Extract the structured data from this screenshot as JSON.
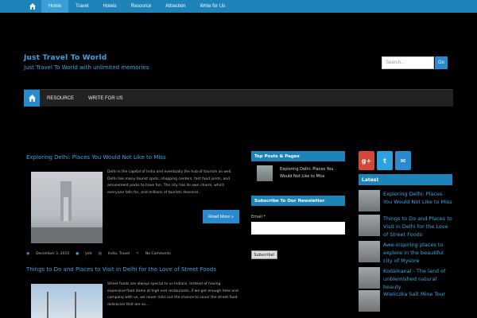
{
  "topnav": {
    "items": [
      "Home",
      "Travel",
      "Hotels",
      "Resource",
      "Attraction",
      "Write for Us"
    ]
  },
  "header": {
    "title": "Just Travel To World",
    "tagline": "Just Travel To World with unlimited memories",
    "search_placeholder": "Search...",
    "search_button": "Go"
  },
  "mainnav": {
    "items": [
      "RESOURCE",
      "WRITE FOR US"
    ]
  },
  "posts": [
    {
      "title": "Exploring Delhi: Places You Would Not Like to Miss",
      "excerpt": "Delhi is the capital of India and eventually the hub of tourism as well. Delhi has many tourist spots, shopping centers, fast food joints, and amusement parks to have fun. The city has its own charm, which everyone falls for, and millions of tourists descend...",
      "read_more": "Read More »",
      "meta": {
        "date": "December 3, 2015",
        "author": "yeti",
        "categories": "India, Travel",
        "comments": "No Comments"
      }
    },
    {
      "title": "Things to Do and Places to Visit in Delhi for the Love of Street Foods",
      "excerpt": "Street foods are always special to us Indians. Instead of having expensive food items at high end restaurants, if we get enough time and company with us, we never miss out the chance to savor the street food delicacies that are so..."
    }
  ],
  "widgets": {
    "top_posts_title": "Top Posts & Pages",
    "top_post_link": "Exploring Delhi: Places You Would Not Like to Miss",
    "newsletter_title": "Subscribe To Our Newsletter",
    "email_label": "Email *",
    "subscribe_button": "Subscribe!"
  },
  "social": {
    "gplus": "g+",
    "twitter": "t",
    "email": "✉"
  },
  "latest": {
    "title": "Latest",
    "items": [
      "Exploring Delhi: Places You Would Not Like to Miss",
      "Things to Do and Places to Visit in Delhi for the Love of Street Foods",
      "Awe-inspiring places to explore in the beautiful city of Mysore",
      "Kodaikanal - The land of unblemished natural beauty",
      "Wieliczka Salt Mine Tour"
    ]
  },
  "colors": {
    "accent": "#1e83b8",
    "link": "#39a6e0",
    "background": "#000000"
  }
}
